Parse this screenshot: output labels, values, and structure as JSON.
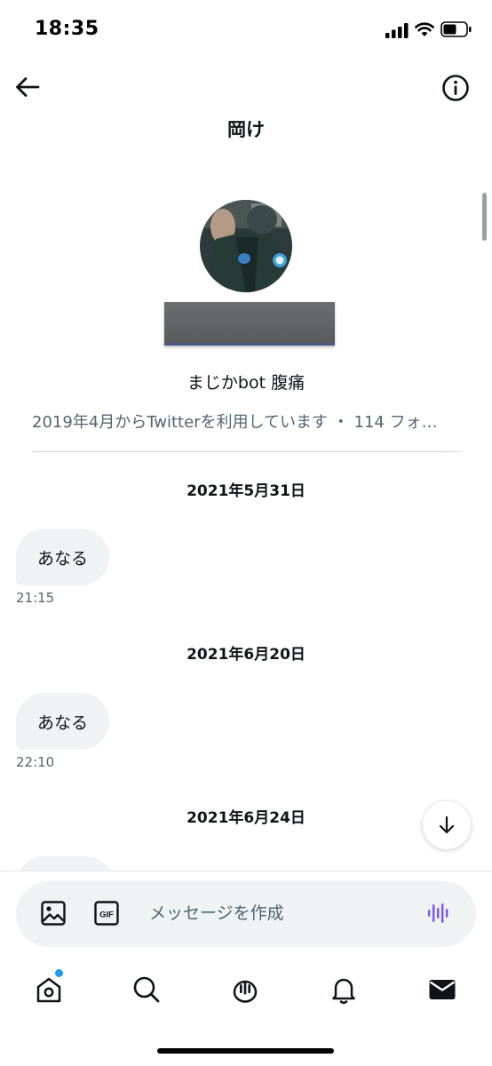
{
  "status_bar": {
    "time": "18:35"
  },
  "header": {
    "title": "岡け"
  },
  "profile": {
    "display_name": "まじかbot 腹痛",
    "meta": "2019年4月からTwitterを利用しています ・ 114 フォ…"
  },
  "messages": [
    {
      "date": "2021年5月31日",
      "text": "あなる",
      "time": "21:15"
    },
    {
      "date": "2021年6月20日",
      "text": "あなる",
      "time": "22:10"
    },
    {
      "date": "2021年6月24日",
      "text": "",
      "time": ""
    }
  ],
  "composer": {
    "placeholder": "メッセージを作成",
    "gif_label": "GIF"
  },
  "bottom_nav": {
    "items": [
      "home-icon",
      "search-icon",
      "spaces-icon",
      "notifications-icon",
      "messages-icon"
    ],
    "has_notification_dot": true
  },
  "colors": {
    "accent": "#1d9bf0",
    "voice": "#7856ff",
    "bubble": "#eff3f4",
    "secondary_text": "#536471"
  }
}
